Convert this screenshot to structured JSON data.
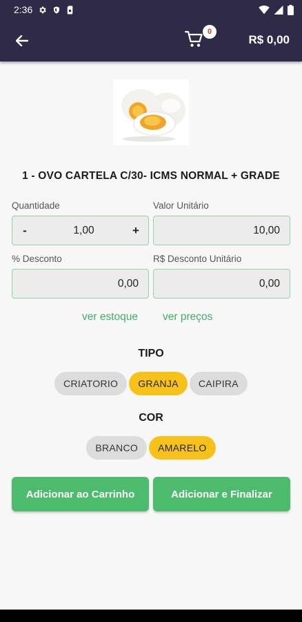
{
  "status_bar": {
    "time": "2:36"
  },
  "header": {
    "cart_count": "0",
    "cart_total": "R$ 0,00"
  },
  "product": {
    "title": "1 - OVO CARTELA C/30- ICMS NORMAL + GRADE"
  },
  "quantity": {
    "label": "Quantidade",
    "value": "1,00",
    "minus": "-",
    "plus": "+"
  },
  "unit_value": {
    "label": "Valor Unitário",
    "value": "10,00"
  },
  "discount_pct": {
    "label": "% Desconto",
    "value": "0,00"
  },
  "discount_unit": {
    "label": "R$ Desconto Unitário",
    "value": "0,00"
  },
  "links": {
    "stock": "ver estoque",
    "prices": "ver preços"
  },
  "tipo": {
    "title": "TIPO",
    "options": [
      "CRIATORIO",
      "GRANJA",
      "CAIPIRA"
    ],
    "selected": "GRANJA"
  },
  "cor": {
    "title": "COR",
    "options": [
      "BRANCO",
      "AMARELO"
    ],
    "selected": "AMARELO"
  },
  "actions": {
    "add_to_cart": "Adicionar ao Carrinho",
    "add_and_finish": "Adicionar e Finalizar"
  },
  "colors": {
    "header": "#2e2a48",
    "accent": "#4cbb6d",
    "chip_selected": "#f6c21a",
    "chip": "#dcdcdc",
    "field_border": "#8ed4a4"
  }
}
